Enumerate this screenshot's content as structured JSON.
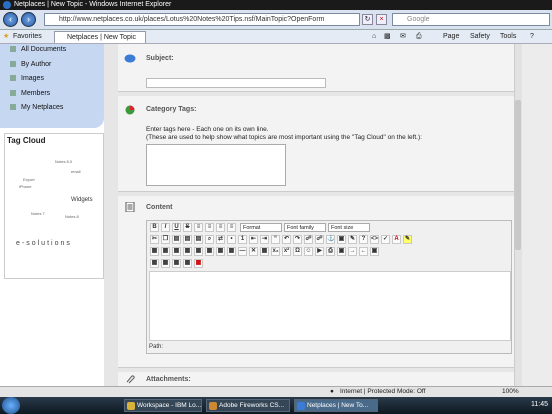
{
  "window": {
    "title": "Netplaces | New Topic - Windows Internet Explorer"
  },
  "browser": {
    "address": "http://www.netplaces.co.uk/places/Lotus%20Notes%20Tips.nsf/MainTopic?OpenForm",
    "search_placeholder": "Google",
    "favorites_label": "Favorites",
    "tab_label": "Netplaces | New Topic",
    "menu": {
      "page": "Page",
      "safety": "Safety",
      "tools": "Tools"
    }
  },
  "sidebar": {
    "items": [
      {
        "label": "All Documents"
      },
      {
        "label": "By Author"
      },
      {
        "label": "Images"
      },
      {
        "label": "Members"
      },
      {
        "label": "My Netplaces"
      }
    ],
    "tag_cloud_title": "Tag Cloud",
    "tags": [
      "Notes 8.0",
      "email",
      "Export",
      "iPhone",
      "Widgets",
      "Notes 7",
      "Notes 8"
    ],
    "brand": "e-solutions"
  },
  "form": {
    "subject_label": "Subject:",
    "tags_label": "Category Tags:",
    "tags_help_1": "Enter tags here - Each one on its own line.",
    "tags_help_2": "(These are used to help show what topics are most important using the \"Tag Cloud\" on the left.):",
    "content_label": "Content",
    "format_select": "Format",
    "font_family_select": "Font family",
    "font_size_select": "Font size",
    "path_label": "Path:",
    "attachments_label": "Attachments:"
  },
  "status": {
    "zone": "Internet | Protected Mode: Off",
    "zoom": "100%"
  },
  "taskbar": {
    "items": [
      {
        "label": "Workspace - IBM Lo..."
      },
      {
        "label": "Adobe Fireworks CS..."
      },
      {
        "label": "Netplaces | New To..."
      }
    ],
    "clock": "11:45"
  },
  "colors": {
    "sidebar_bg": "#c6d7f1",
    "titlebar": "#1a1a1a",
    "main_bg": "#e6e6e6"
  }
}
